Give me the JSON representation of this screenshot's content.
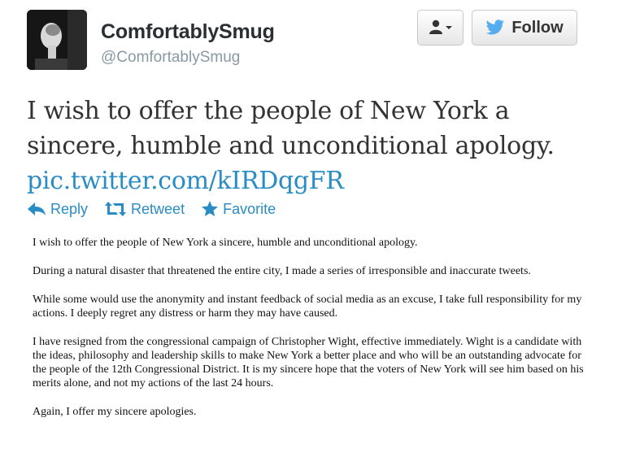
{
  "user": {
    "display_name": "ComfortablySmug",
    "handle": "@ComfortablySmug"
  },
  "buttons": {
    "user_menu_icon": "person-dropdown-icon",
    "follow_label": "Follow",
    "follow_icon": "twitter-bird-icon"
  },
  "tweet": {
    "line1": "I wish to offer the people of New York a",
    "line2": "sincere, humble and unconditional apology.",
    "link": "pic.twitter.com/kIRDqgFR"
  },
  "actions": {
    "reply": "Reply",
    "retweet": "Retweet",
    "favorite": "Favorite"
  },
  "statement": {
    "paragraphs": [
      "I wish to offer the people of New York a sincere, humble and unconditional apology.",
      "During a natural disaster that threatened the entire city, I made a series of irresponsible and inaccurate tweets.",
      "While some would use the anonymity and instant feedback of social media as an excuse, I take full responsibility for my actions.  I deeply regret any distress or harm they may have caused.",
      "I have resigned from the congressional campaign of Christopher Wight, effective immediately.  Wight is a candidate with the ideas, philosophy and leadership skills to make New York a better place and who will be an outstanding advocate for the people of the 12th Congressional District. It is my sincere hope that the voters of New York will see him based on his merits alone, and not my actions of the last 24 hours.",
      "Again, I offer my sincere apologies."
    ]
  },
  "colors": {
    "link": "#2a8cc4",
    "handle": "#8899a6",
    "text": "#333333"
  }
}
